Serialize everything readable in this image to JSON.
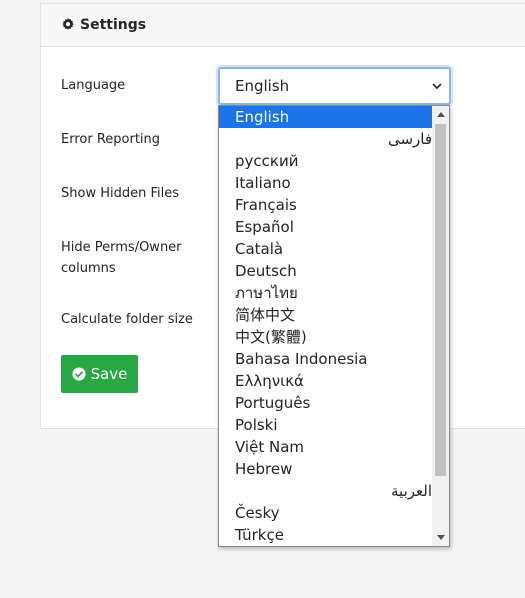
{
  "card": {
    "title": "Settings",
    "title_icon": "gear-icon"
  },
  "form": {
    "labels": {
      "language": "Language",
      "error_reporting": "Error Reporting",
      "show_hidden_files": "Show Hidden Files",
      "hide_perms_line1": "Hide Perms/Owner",
      "hide_perms_line2": "columns",
      "calc_folder_size": "Calculate folder size"
    },
    "language_select": {
      "value": "English",
      "options": [
        "English",
        "فارسی",
        "русский",
        "Italiano",
        "Français",
        "Español",
        "Català",
        "Deutsch",
        "ภาษาไทย",
        "简体中文",
        "中文(繁體)",
        "Bahasa Indonesia",
        "Ελληνικά",
        "Português",
        "Polski",
        "Việt Nam",
        "Hebrew",
        "العربية",
        "Česky",
        "Türkçe"
      ],
      "selected_index": 0
    },
    "save_label": "Save",
    "save_icon": "check-circle-icon"
  },
  "colors": {
    "accent": "#1a73e8",
    "save_button": "#28a745",
    "focus_border": "#8bb7e7"
  }
}
